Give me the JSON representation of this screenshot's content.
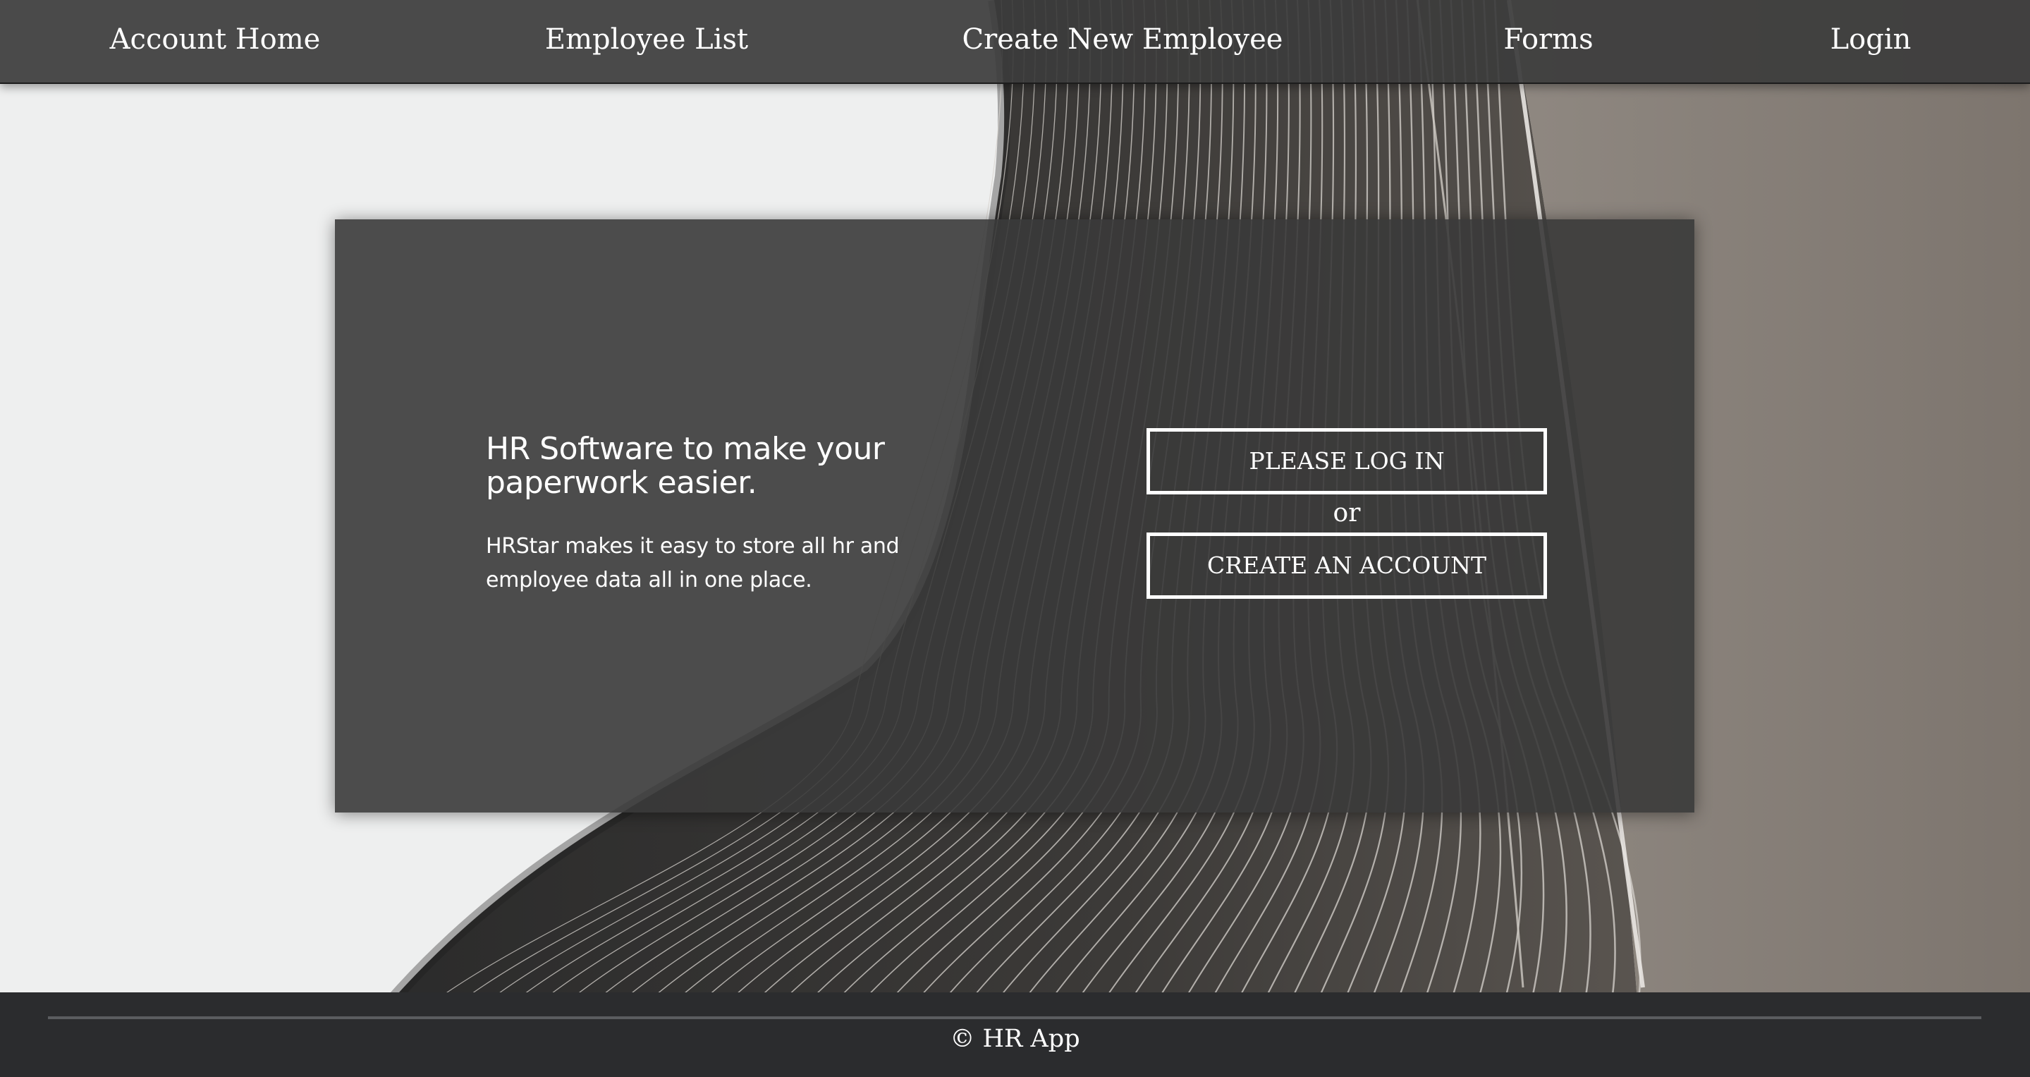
{
  "nav": {
    "items": [
      {
        "label": "Account Home"
      },
      {
        "label": "Employee List"
      },
      {
        "label": "Create New Employee"
      },
      {
        "label": "Forms"
      },
      {
        "label": "Login"
      }
    ]
  },
  "hero": {
    "heading": "HR Software to make your paperwork easier.",
    "description": "HRStar makes it easy to store all hr and employee data all in one place.",
    "login_button": "PLEASE LOG IN",
    "or_text": "or",
    "create_account_button": "CREATE AN ACCOUNT"
  },
  "footer": {
    "text": "© HR App"
  },
  "colors": {
    "nav_background": "#3c3c3c",
    "card_background": "#3a3a3a",
    "footer_background": "#2b2c2e",
    "page_background": "#eeefef",
    "button_border": "#ffffff"
  }
}
